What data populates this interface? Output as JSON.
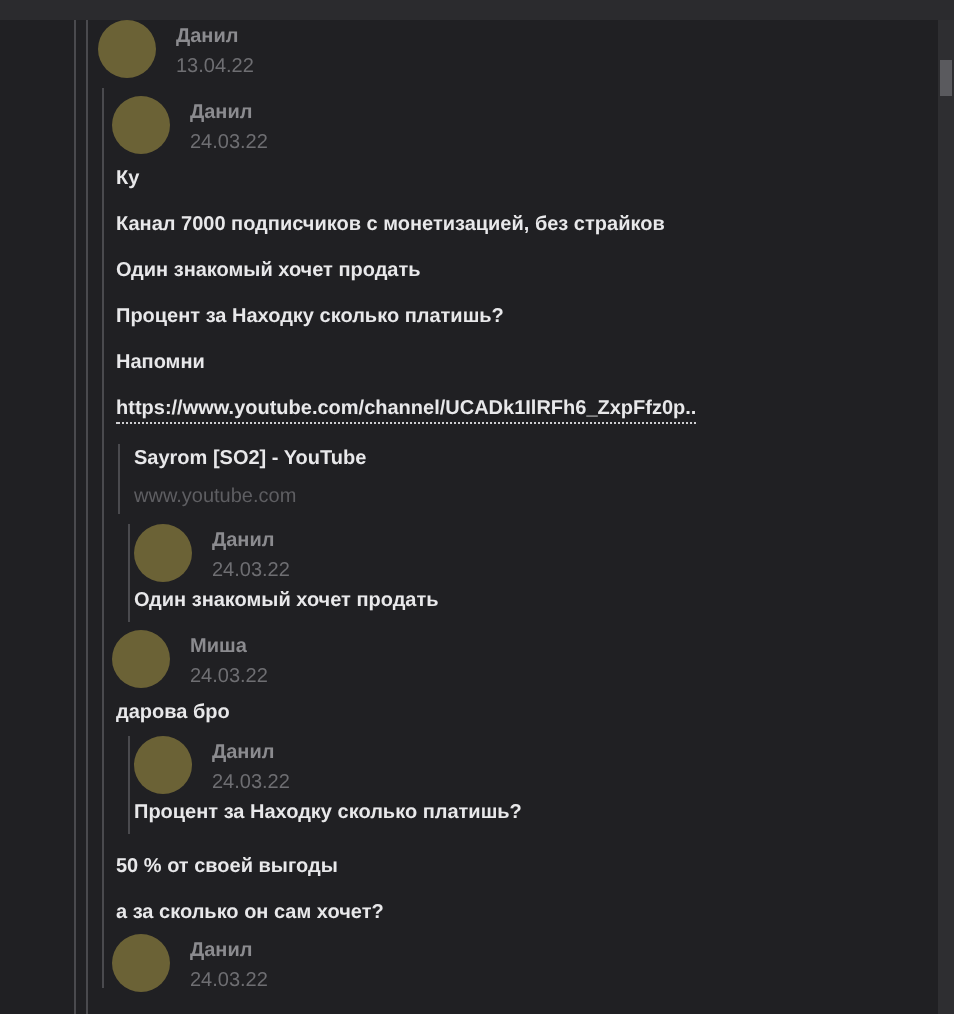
{
  "message": {
    "author": "Данил",
    "date": "13.04.22"
  },
  "thread": [
    {
      "kind": "header",
      "author": "Данил",
      "date": "24.03.22"
    },
    {
      "kind": "text",
      "text": "Ку"
    },
    {
      "kind": "text",
      "text": "Канал 7000 подписчиков с монетизацией, без страйков"
    },
    {
      "kind": "text",
      "text": "Один знакомый хочет продать"
    },
    {
      "kind": "text",
      "text": "Процент за Находку сколько платишь?"
    },
    {
      "kind": "text",
      "text": "Напомни"
    },
    {
      "kind": "link",
      "text": "https://www.youtube.com/channel/UCADk1IlRFh6_ZxpFfz0p.."
    },
    {
      "kind": "preview",
      "title": "Sayrom [SO2] - YouTube",
      "site": "www.youtube.com"
    },
    {
      "kind": "quote",
      "author": "Данил",
      "date": "24.03.22",
      "text": "Один знакомый хочет продать"
    },
    {
      "kind": "header",
      "author": "Миша",
      "date": "24.03.22"
    },
    {
      "kind": "text",
      "text": "дарова бро"
    },
    {
      "kind": "quote",
      "author": "Данил",
      "date": "24.03.22",
      "text": "Процент за Находку сколько платишь?"
    },
    {
      "kind": "text",
      "text": "50 % от своей выгоды"
    },
    {
      "kind": "text",
      "text": "а за сколько он сам хочет?"
    },
    {
      "kind": "header",
      "author": "Данил",
      "date": "24.03.22"
    }
  ]
}
